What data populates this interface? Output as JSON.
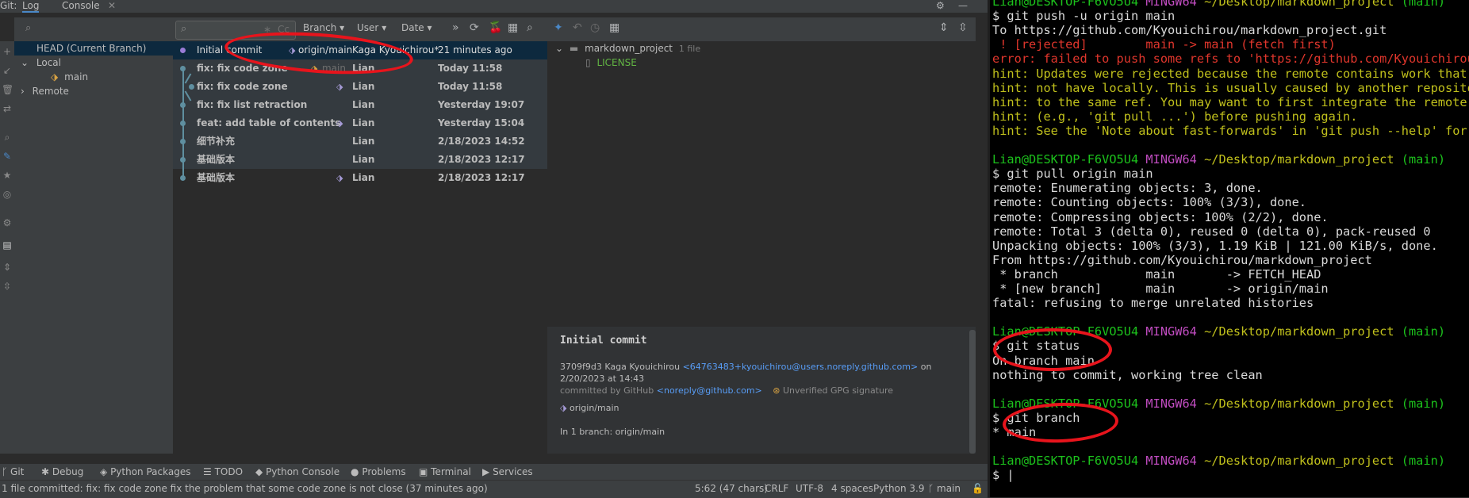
{
  "ide": {
    "topbar": {
      "git_label": "Git:",
      "tab_log": "Log",
      "tab_console": "Console"
    },
    "branch_panel": {
      "head": "HEAD (Current Branch)",
      "local": "Local",
      "local_branch": "main",
      "remote": "Remote"
    },
    "log_toolbar": {
      "filter_placeholder": "",
      "cc_label": "Cc",
      "branch_filter": "Branch",
      "user_filter": "User",
      "date_filter": "Date"
    },
    "commits": [
      {
        "message": "Initial commit",
        "ref": "origin/main",
        "author": "Kaga Kyouichirou*",
        "date": "21 minutes ago"
      },
      {
        "message": "fix: fix code zone",
        "ref": "main",
        "author": "Lian",
        "date": "Today 11:58"
      },
      {
        "message": "fix: fix code zone",
        "ref": "",
        "author": "Lian",
        "date": "Today 11:58"
      },
      {
        "message": "fix: fix list retraction",
        "ref": "",
        "author": "Lian",
        "date": "Yesterday 19:07"
      },
      {
        "message": "feat: add table of contents",
        "ref": "",
        "author": "Lian",
        "date": "Yesterday 15:04"
      },
      {
        "message": "细节补充",
        "ref": "",
        "author": "Lian",
        "date": "2/18/2023 14:52"
      },
      {
        "message": "基础版本",
        "ref": "",
        "author": "Lian",
        "date": "2/18/2023 12:17"
      },
      {
        "message": "基础版本",
        "ref": "",
        "author": "Lian",
        "date": "2/18/2023 12:17"
      }
    ],
    "changes": {
      "root": "markdown_project",
      "count": "1 file",
      "file": "LICENSE"
    },
    "details": {
      "title": "Initial commit",
      "hash_author": "3709f9d3 Kaga Kyouichirou",
      "email": "<64763483+kyouichirou@users.noreply.github.com>",
      "on": "on",
      "datetime": "2/20/2023 at 14:43",
      "committed_by": "committed by GitHub",
      "committer_email": "<noreply@github.com>",
      "gpg": "Unverified GPG signature",
      "ref": "origin/main",
      "in_branch": "In 1 branch: origin/main"
    },
    "bottom_tabs": [
      "Git",
      "Debug",
      "Python Packages",
      "TODO",
      "Python Console",
      "Problems",
      "Terminal",
      "Services"
    ],
    "status": {
      "message": "1 file committed: fix: fix code zone fix the problem that some code zone is not close (37 minutes ago)",
      "position": "5:62 (47 chars)",
      "line_sep": "CRLF",
      "encoding": "UTF-8",
      "indent": "4 spaces",
      "interpreter": "Python 3.9",
      "branch": "main"
    }
  },
  "terminal": {
    "prompt_user": "Lian@DESKTOP-F6VO5U4",
    "prompt_env": "MINGW64",
    "prompt_path": "~/Desktop/markdown_project",
    "prompt_branch": "(main)",
    "lines": [
      {
        "type": "prompt"
      },
      {
        "type": "cmd",
        "text": "$ git push -u origin main"
      },
      {
        "type": "out",
        "text": "To https://github.com/Kyouichirou/markdown_project.git"
      },
      {
        "type": "rejected",
        "text": " ! [rejected]        main -> main (fetch first)"
      },
      {
        "type": "error",
        "text": "error: failed to push some refs to 'https://github.com/Kyouichirou/markdown_project.git'"
      },
      {
        "type": "hint",
        "text": "hint: Updates were rejected because the remote contains work that you do"
      },
      {
        "type": "hint",
        "text": "hint: not have locally. This is usually caused by another repository pushing"
      },
      {
        "type": "hint",
        "text": "hint: to the same ref. You may want to first integrate the remote changes"
      },
      {
        "type": "hint",
        "text": "hint: (e.g., 'git pull ...') before pushing again."
      },
      {
        "type": "hint",
        "text": "hint: See the 'Note about fast-forwards' in 'git push --help' for details."
      },
      {
        "type": "blank",
        "text": ""
      },
      {
        "type": "prompt"
      },
      {
        "type": "cmd",
        "text": "$ git pull origin main"
      },
      {
        "type": "out",
        "text": "remote: Enumerating objects: 3, done."
      },
      {
        "type": "out",
        "text": "remote: Counting objects: 100% (3/3), done."
      },
      {
        "type": "out",
        "text": "remote: Compressing objects: 100% (2/2), done."
      },
      {
        "type": "out",
        "text": "remote: Total 3 (delta 0), reused 0 (delta 0), pack-reused 0"
      },
      {
        "type": "out",
        "text": "Unpacking objects: 100% (3/3), 1.19 KiB | 121.00 KiB/s, done."
      },
      {
        "type": "out",
        "text": "From https://github.com/Kyouichirou/markdown_project"
      },
      {
        "type": "out",
        "text": " * branch            main       -> FETCH_HEAD"
      },
      {
        "type": "out",
        "text": " * [new branch]      main       -> origin/main"
      },
      {
        "type": "out",
        "text": "fatal: refusing to merge unrelated histories"
      },
      {
        "type": "blank",
        "text": ""
      },
      {
        "type": "prompt"
      },
      {
        "type": "cmd",
        "text": "$ git status"
      },
      {
        "type": "out",
        "text": "On branch main"
      },
      {
        "type": "out",
        "text": "nothing to commit, working tree clean"
      },
      {
        "type": "blank",
        "text": ""
      },
      {
        "type": "prompt"
      },
      {
        "type": "cmd",
        "text": "$ git branch"
      },
      {
        "type": "out",
        "text": "* main"
      },
      {
        "type": "blank",
        "text": ""
      },
      {
        "type": "prompt"
      },
      {
        "type": "cmd",
        "text": "$ |"
      }
    ]
  },
  "colors": {
    "annotation": "#e8141c",
    "selected_row": "#0d293e",
    "link": "#589df6",
    "file_green": "#62b543",
    "tag": "#a59ad6"
  }
}
